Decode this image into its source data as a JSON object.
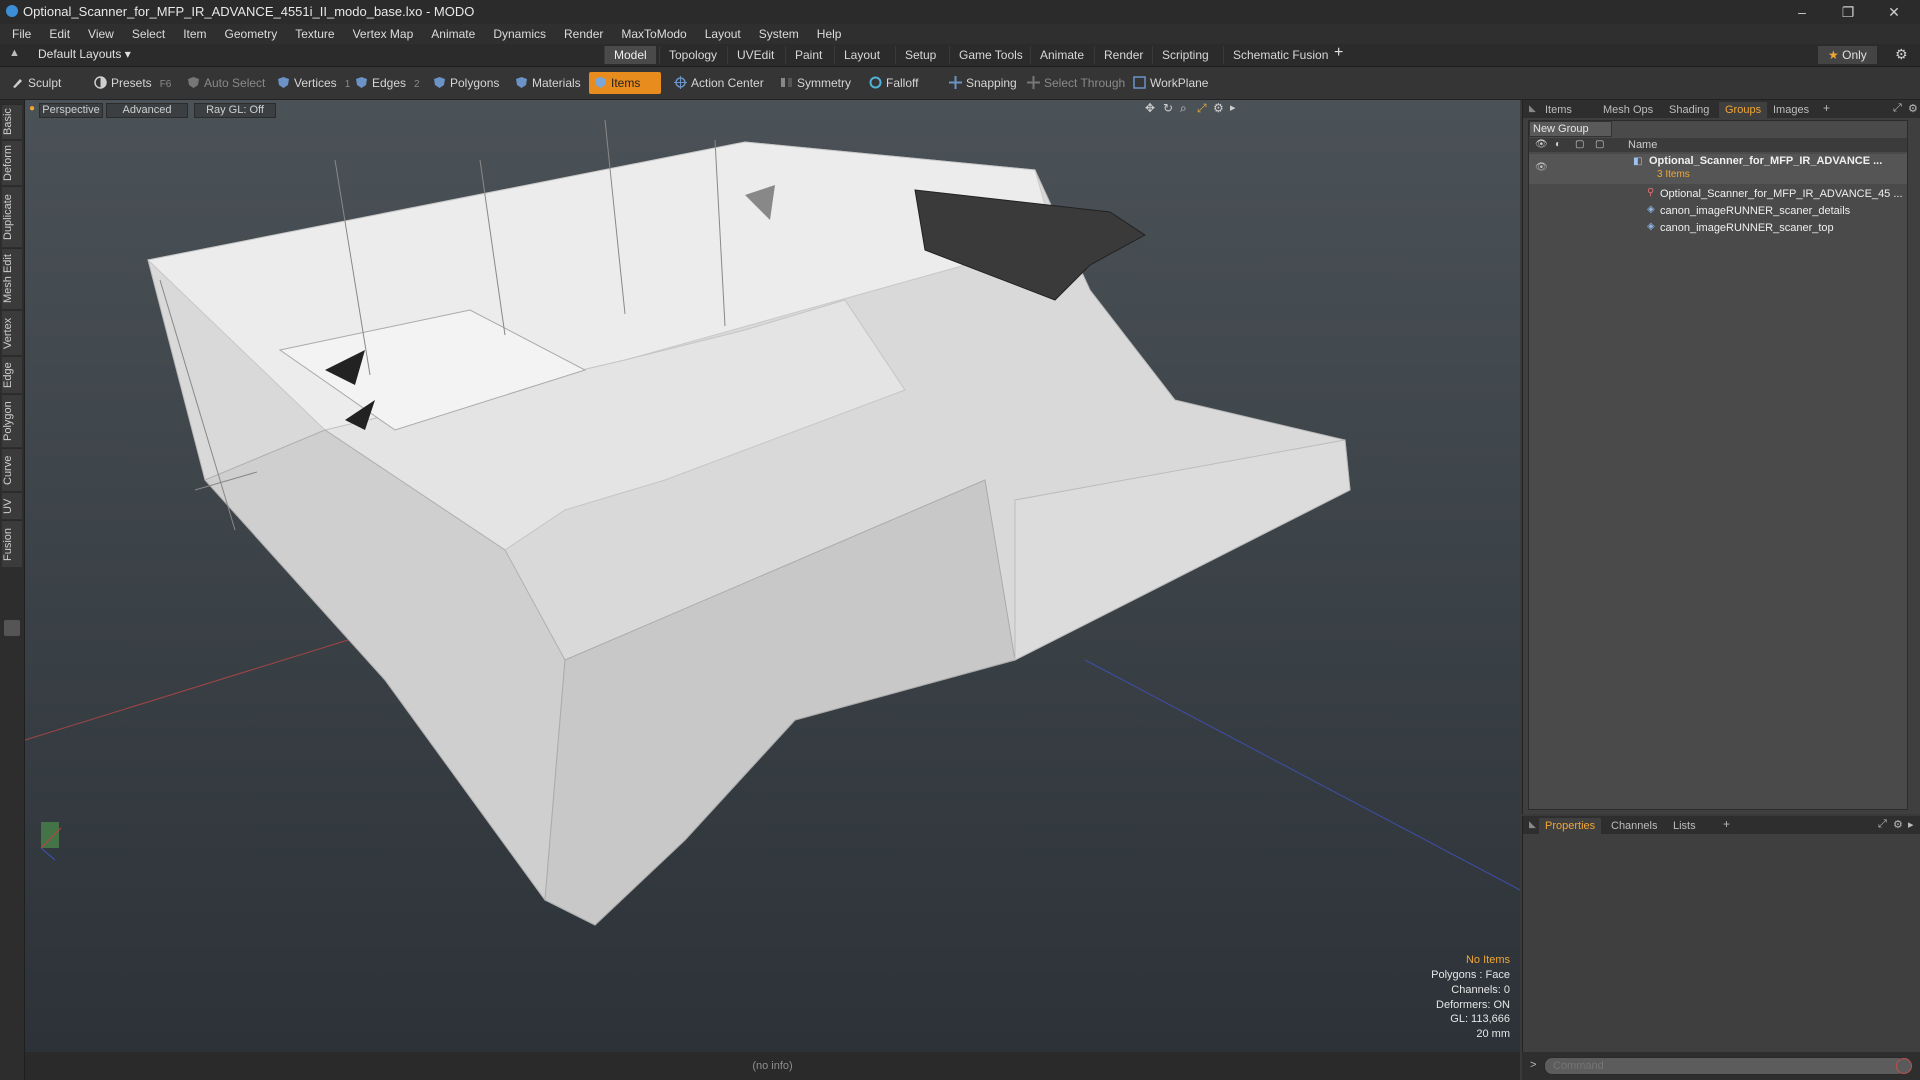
{
  "window": {
    "title": "Optional_Scanner_for_MFP_IR_ADVANCE_4551i_II_modo_base.lxo - MODO",
    "minimize_glyph": "–",
    "restore_glyph": "❐",
    "close_glyph": "✕"
  },
  "menu": [
    "File",
    "Edit",
    "View",
    "Select",
    "Item",
    "Geometry",
    "Texture",
    "Vertex Map",
    "Animate",
    "Dynamics",
    "Render",
    "MaxToModo",
    "Layout",
    "System",
    "Help"
  ],
  "layout": {
    "selector": "Default Layouts",
    "tabs": [
      "Model",
      "Topology",
      "UVEdit",
      "Paint",
      "Layout",
      "Setup",
      "Game Tools",
      "Animate",
      "Render",
      "Scripting",
      "Schematic Fusion"
    ],
    "active_tab": "Model",
    "add_glyph": "+",
    "only_label": "Only"
  },
  "toolbar": {
    "sculpt": "Sculpt",
    "presets": "Presets",
    "presets_key": "F6",
    "auto_select": "Auto Select",
    "vertices": "Vertices",
    "vertices_key": "1",
    "edges": "Edges",
    "edges_key": "2",
    "polygons": "Polygons",
    "materials": "Materials",
    "items": "Items",
    "action_center": "Action Center",
    "symmetry": "Symmetry",
    "falloff": "Falloff",
    "snapping": "Snapping",
    "select_through": "Select Through",
    "workplane": "WorkPlane"
  },
  "left_tabs": [
    "Basic",
    "Deform",
    "Duplicate",
    "Mesh Edit",
    "Vertex",
    "Edge",
    "Polygon",
    "Curve",
    "UV",
    "Fusion"
  ],
  "viewport": {
    "view": "Perspective",
    "shading": "Advanced",
    "raygl": "Ray GL: Off",
    "hud": {
      "no_items": "No Items",
      "polygons": "Polygons : Face",
      "channels": "Channels: 0",
      "deformers": "Deformers: ON",
      "gl": "GL: 113,666",
      "scale": "20 mm"
    }
  },
  "status": "(no info)",
  "groups_panel": {
    "tabs": [
      "Items",
      "Mesh Ops",
      "Shading",
      "Groups",
      "Images"
    ],
    "active_tab": "Groups",
    "new_group": "New Group",
    "name_header": "Name",
    "group_name": "Optional_Scanner_for_MFP_IR_ADVANCE ...",
    "group_count": "3 Items",
    "items": [
      "Optional_Scanner_for_MFP_IR_ADVANCE_45 ...",
      "canon_imageRUNNER_scaner_details",
      "canon_imageRUNNER_scaner_top"
    ]
  },
  "properties_panel": {
    "tabs": [
      "Properties",
      "Channels",
      "Lists"
    ],
    "active_tab": "Properties"
  },
  "command": {
    "placeholder": "Command",
    "prompt": ">"
  },
  "colors": {
    "accent": "#e88c1e",
    "active_tab_text": "#f0a635",
    "viewport_top": "#4b5257",
    "viewport_bottom": "#2c3237"
  }
}
